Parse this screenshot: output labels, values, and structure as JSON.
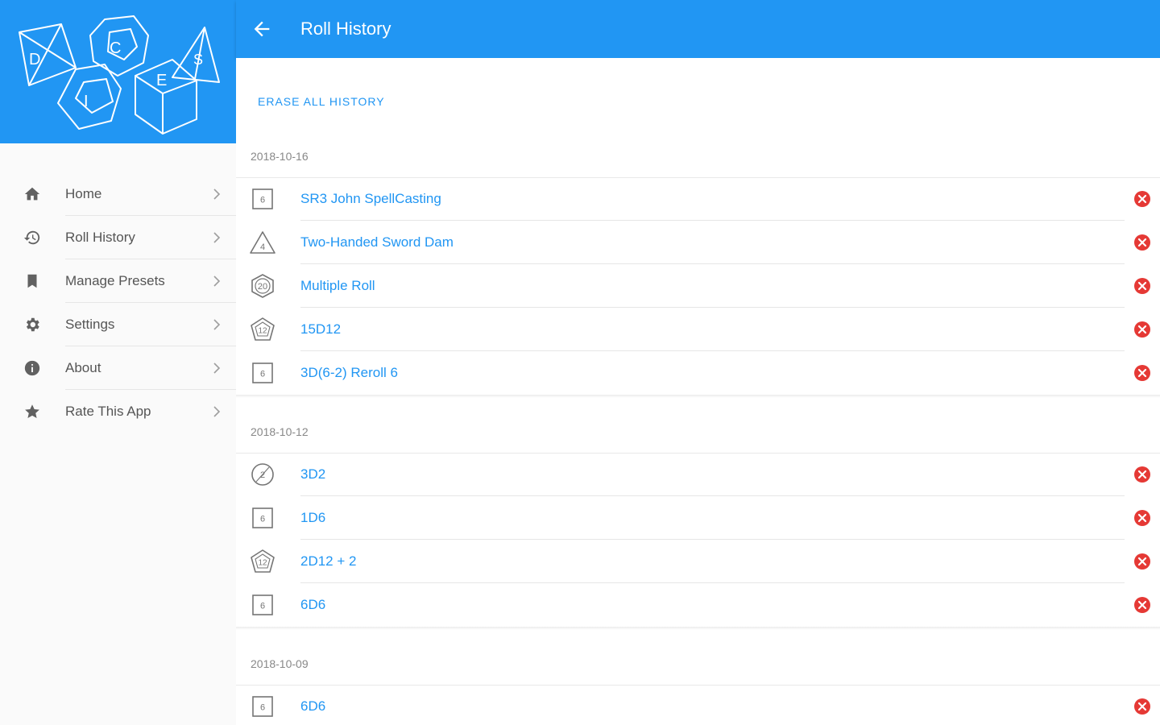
{
  "appbar": {
    "title": "Roll History"
  },
  "drawer": {
    "header_logo_letters": "DICES",
    "items": [
      {
        "label": "Home",
        "icon": "home-icon"
      },
      {
        "label": "Roll History",
        "icon": "history-icon"
      },
      {
        "label": "Manage Presets",
        "icon": "bookmark-icon"
      },
      {
        "label": "Settings",
        "icon": "gear-icon"
      },
      {
        "label": "About",
        "icon": "info-icon"
      },
      {
        "label": "Rate This App",
        "icon": "star-icon"
      }
    ]
  },
  "content": {
    "erase_label": "ERASE ALL HISTORY",
    "sections": [
      {
        "date": "2018-10-16",
        "rows": [
          {
            "die": "6",
            "label": "SR3 John SpellCasting"
          },
          {
            "die": "4",
            "label": "Two-Handed Sword Dam"
          },
          {
            "die": "20",
            "label": "Multiple Roll"
          },
          {
            "die": "12",
            "label": "15D12"
          },
          {
            "die": "6",
            "label": "3D(6-2) Reroll 6"
          }
        ]
      },
      {
        "date": "2018-10-12",
        "rows": [
          {
            "die": "2",
            "label": "3D2"
          },
          {
            "die": "6",
            "label": "1D6"
          },
          {
            "die": "12",
            "label": "2D12 + 2"
          },
          {
            "die": "6",
            "label": "6D6"
          }
        ]
      },
      {
        "date": "2018-10-09",
        "rows": [
          {
            "die": "6",
            "label": "6D6"
          }
        ]
      }
    ]
  },
  "colors": {
    "primary": "#2196f3",
    "delete": "#e53935"
  }
}
